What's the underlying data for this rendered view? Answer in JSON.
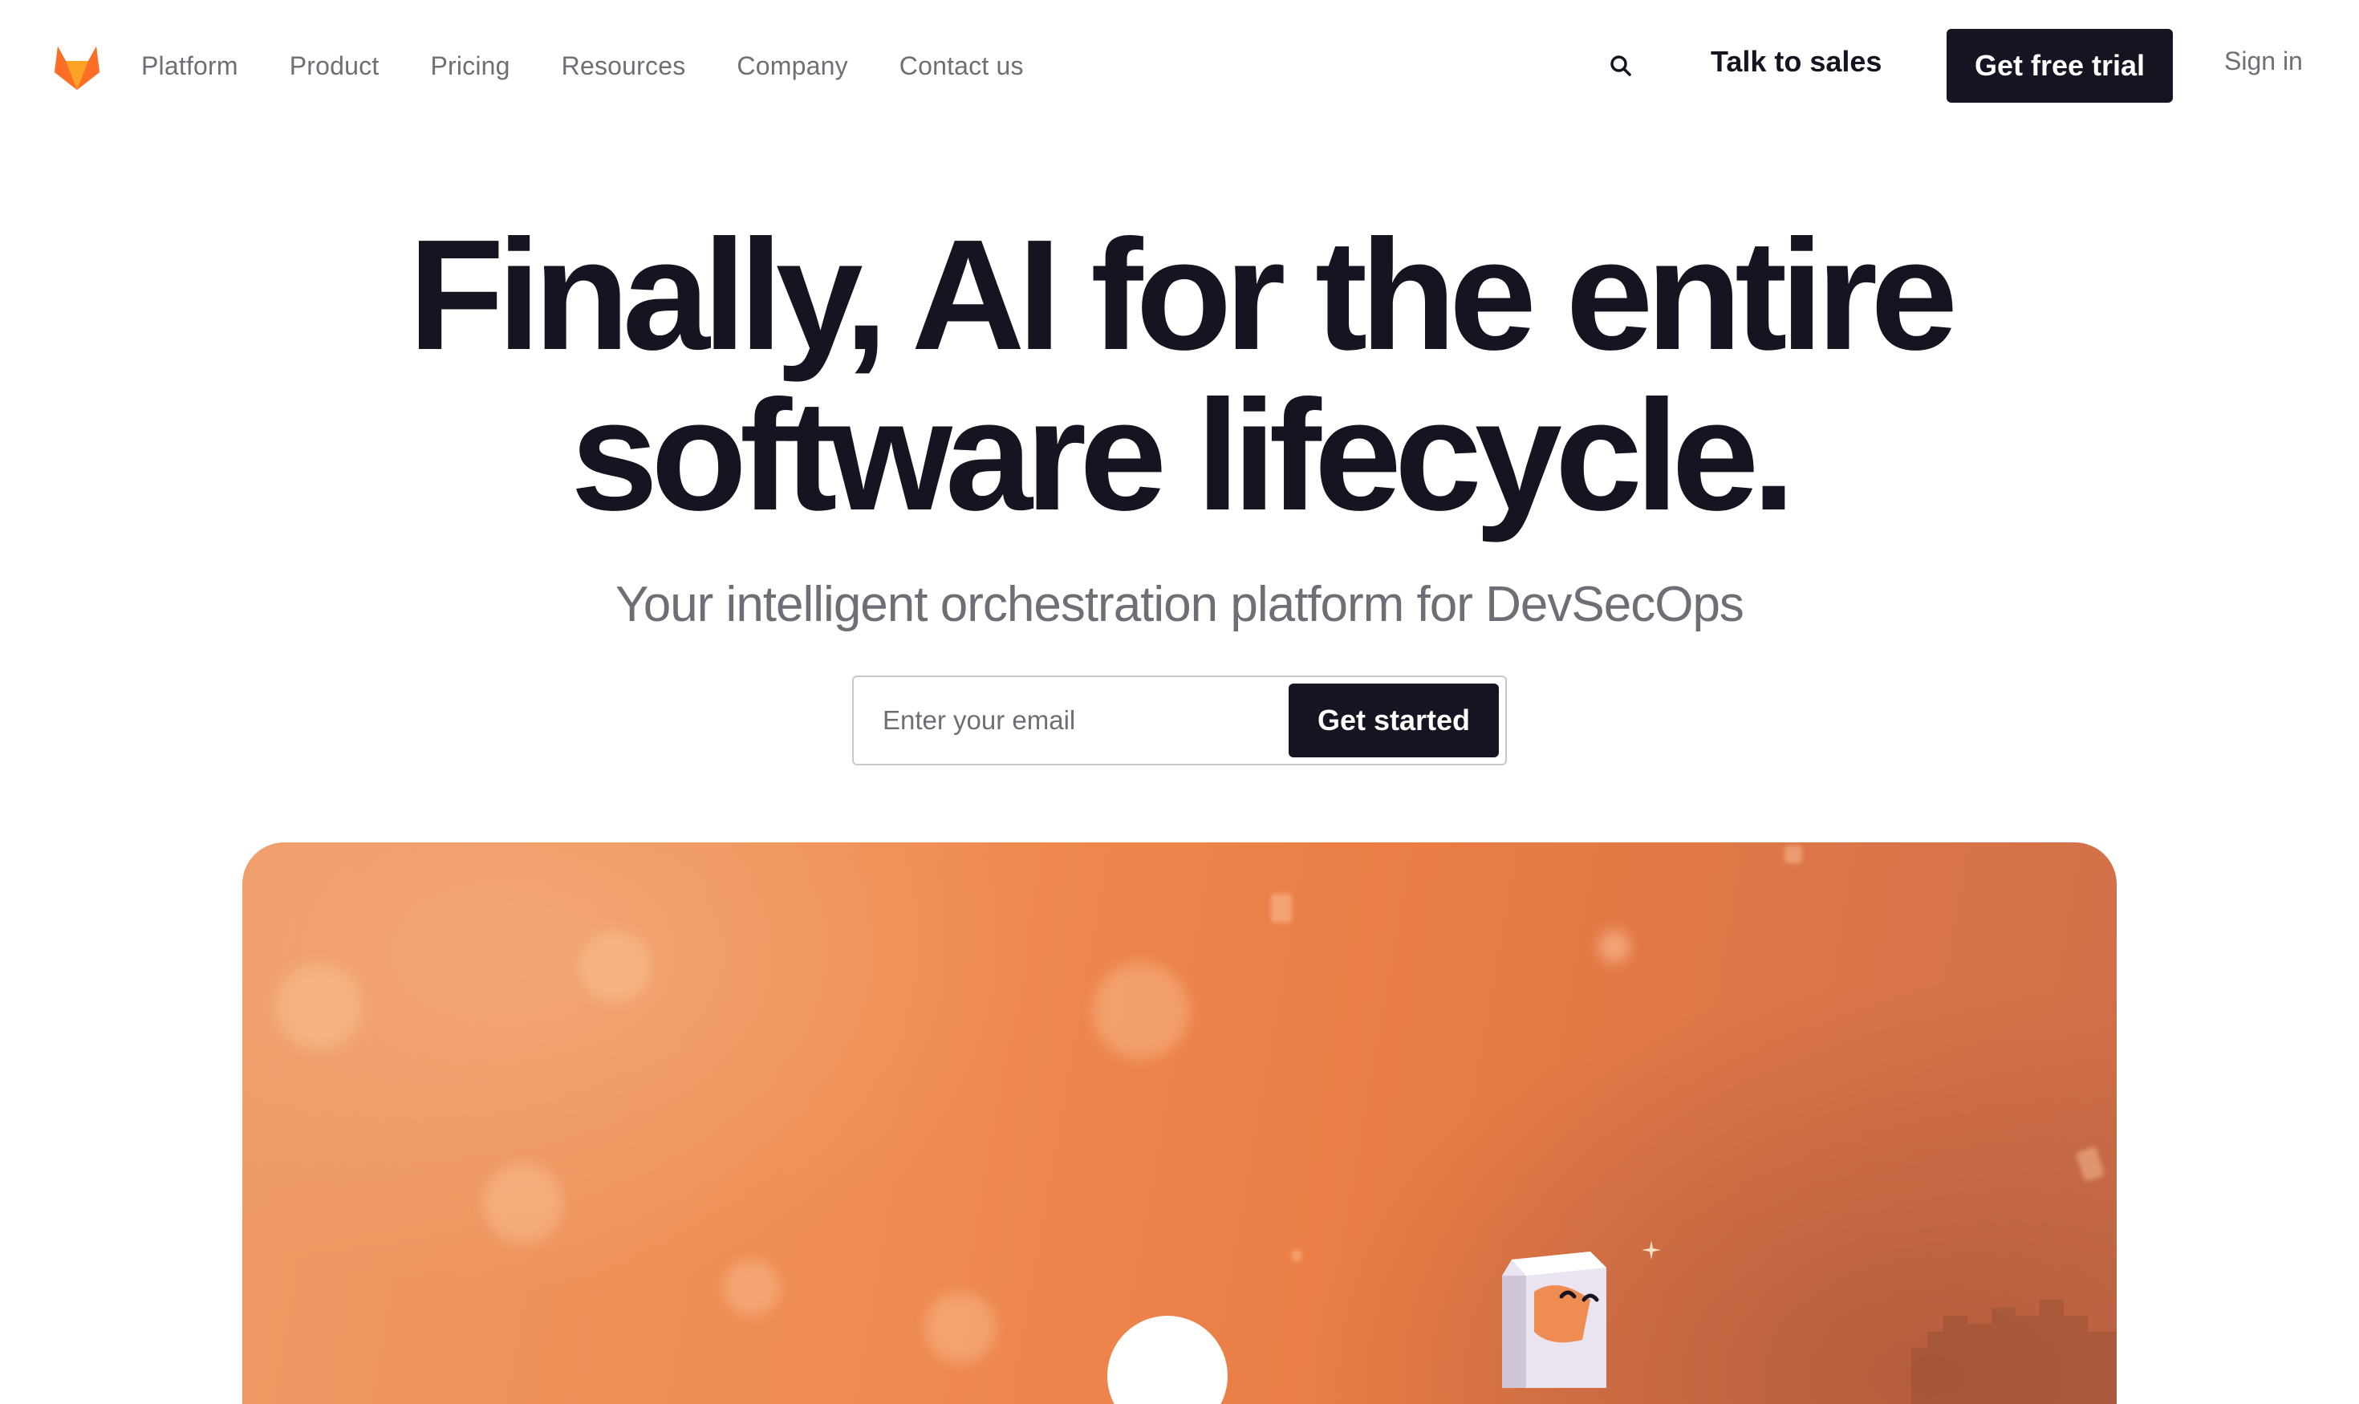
{
  "nav": {
    "logo_alt": "GitLab",
    "links": [
      {
        "label": "Platform"
      },
      {
        "label": "Product"
      },
      {
        "label": "Pricing"
      },
      {
        "label": "Resources"
      },
      {
        "label": "Company"
      },
      {
        "label": "Contact us"
      }
    ],
    "search_icon": "search-icon",
    "talk_to_sales": "Talk to sales",
    "free_trial": "Get free trial",
    "sign_in": "Sign in"
  },
  "hero": {
    "title_line1": "Finally, AI for the entire",
    "title_line2": "software lifecycle.",
    "subtitle": "Your intelligent orchestration platform for DevSecOps",
    "email_placeholder": "Enter your email",
    "cta": "Get started"
  },
  "colors": {
    "ink": "#171321",
    "muted": "#6e6e76",
    "brand_orange": "#e2432a",
    "panel_orange": "#ef8c52"
  }
}
